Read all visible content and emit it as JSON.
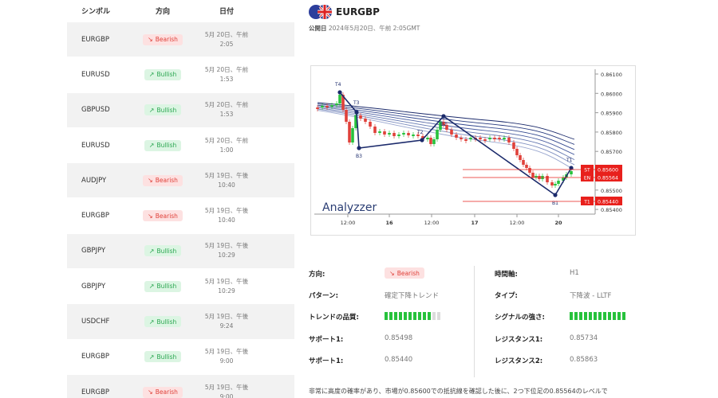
{
  "list": {
    "headers": {
      "symbol": "シンボル",
      "direction": "方向",
      "date": "日付"
    },
    "rows": [
      {
        "symbol": "EURGBP",
        "direction": "Bearish",
        "kind": "bear",
        "date1": "5月 20日、午前",
        "date2": "2:05"
      },
      {
        "symbol": "EURUSD",
        "direction": "Bullish",
        "kind": "bull",
        "date1": "5月 20日、午前",
        "date2": "1:53"
      },
      {
        "symbol": "GBPUSD",
        "direction": "Bullish",
        "kind": "bull",
        "date1": "5月 20日、午前",
        "date2": "1:53"
      },
      {
        "symbol": "EURUSD",
        "direction": "Bullish",
        "kind": "bull",
        "date1": "5月 20日、午前",
        "date2": "1:00"
      },
      {
        "symbol": "AUDJPY",
        "direction": "Bearish",
        "kind": "bear",
        "date1": "5月 19日、午後",
        "date2": "10:40"
      },
      {
        "symbol": "EURGBP",
        "direction": "Bearish",
        "kind": "bear",
        "date1": "5月 19日、午後",
        "date2": "10:40"
      },
      {
        "symbol": "GBPJPY",
        "direction": "Bullish",
        "kind": "bull",
        "date1": "5月 19日、午後",
        "date2": "10:29"
      },
      {
        "symbol": "GBPJPY",
        "direction": "Bullish",
        "kind": "bull",
        "date1": "5月 19日、午後",
        "date2": "10:29"
      },
      {
        "symbol": "USDCHF",
        "direction": "Bullish",
        "kind": "bull",
        "date1": "5月 19日、午後",
        "date2": "9:24"
      },
      {
        "symbol": "EURGBP",
        "direction": "Bullish",
        "kind": "bull",
        "date1": "5月 19日、午後",
        "date2": "9:00"
      },
      {
        "symbol": "EURGBP",
        "direction": "Bearish",
        "kind": "bear",
        "date1": "5月 19日、午後",
        "date2": "9:00"
      }
    ]
  },
  "detail": {
    "symbol": "EURGBP",
    "published_label": "公開日",
    "published_value": "2024年5月20日、午前 2:05GMT",
    "watermark": "Analyzzer",
    "chart": {
      "y_ticks": [
        "0.86100",
        "0.86000",
        "0.85900",
        "0.85800",
        "0.85700",
        "0.85600",
        "0.85500",
        "0.85400"
      ],
      "x_ticks": [
        "12:00",
        "16",
        "12:00",
        "17",
        "12:00",
        "20"
      ],
      "point_labels": [
        "T4",
        "T3",
        "B3",
        "T2",
        "B2",
        "B1",
        "T1"
      ],
      "levels": [
        {
          "tag": "ST",
          "value": "0.85600"
        },
        {
          "tag": "EN",
          "value": "0.85564"
        },
        {
          "tag": "T1",
          "value": "0.85440"
        }
      ]
    },
    "fields": {
      "direction_label": "方向:",
      "direction_value": "Bearish",
      "timeframe_label": "時間軸:",
      "timeframe_value": "H1",
      "pattern_label": "パターン:",
      "pattern_value": "確定下降トレンド",
      "type_label": "タイプ:",
      "type_value": "下降波 - LLTF",
      "quality_label": "トレンドの品質:",
      "quality_level": 0.8,
      "strength_label": "シグナルの強さ:",
      "strength_level": 1.0,
      "support1_label": "サポート1:",
      "support1_value": "0.85498",
      "resistance1_label": "レジスタンス1:",
      "resistance1_value": "0.85734",
      "support2_label": "サポート1:",
      "support2_value": "0.85440",
      "resistance2_label": "レジスタンス2:",
      "resistance2_value": "0.85863"
    },
    "description": "非常に高度の確率があり、市場が0.85600での抵抗線を確認した後に、2つ下位足の0.85564のレベルで"
  },
  "colors": {
    "bear": "#e0413a",
    "bull": "#27c23c",
    "level_red": "#e8201c"
  }
}
